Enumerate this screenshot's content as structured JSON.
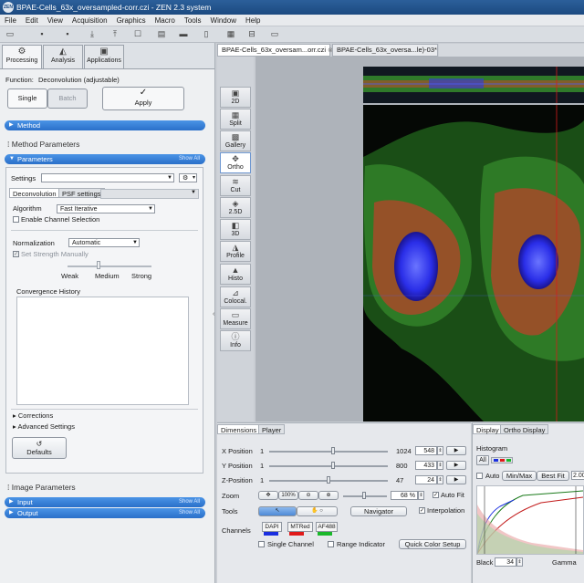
{
  "window": {
    "title": "BPAE-Cells_63x_oversampled-corr.czi - ZEN 2.3 system",
    "app_icon": "ZEN"
  },
  "menu": [
    "File",
    "Edit",
    "View",
    "Acquisition",
    "Graphics",
    "Macro",
    "Tools",
    "Window",
    "Help"
  ],
  "main_tabs": [
    {
      "label": "Processing",
      "icon": "gear-icon",
      "active": true
    },
    {
      "label": "Analysis",
      "icon": "chart-icon",
      "active": false
    },
    {
      "label": "Applications",
      "icon": "apps-icon",
      "active": false
    }
  ],
  "function": {
    "label": "Function:",
    "value": "Deconvolution (adjustable)"
  },
  "batch_toggle": {
    "single": "Single",
    "batch": "Batch"
  },
  "apply_button": {
    "icon": "✓",
    "label": "Apply"
  },
  "method_bar": "Method",
  "method_params_title": "Method Parameters",
  "parameters_bar": {
    "label": "Parameters",
    "show_all": "Show All"
  },
  "settings": {
    "label": "Settings",
    "value": ""
  },
  "subtabs": {
    "deconvolution": "Deconvolution",
    "psf": "PSF settings"
  },
  "algorithm": {
    "label": "Algorithm",
    "value": "Fast Iterative"
  },
  "enable_channel_selection": "Enable Channel Selection",
  "normalization": {
    "label": "Normalization",
    "value": "Automatic"
  },
  "set_strength": "Set Strength Manually",
  "strength_labels": [
    "Weak",
    "Medium",
    "Strong"
  ],
  "convergence_history": "Convergence History",
  "corrections": "Corrections",
  "advanced_settings": "Advanced Settings",
  "defaults_button": "Defaults",
  "image_parameters_title": "Image Parameters",
  "input_bar": {
    "label": "Input",
    "show_all": "Show All"
  },
  "output_bar": {
    "label": "Output",
    "show_all": "Show All"
  },
  "doc_tabs": [
    "BPAE-Cells_63x_oversam...orr.czi",
    "BPAE-Cells_63x_oversa...le)-03*"
  ],
  "view_buttons": [
    {
      "label": "2D",
      "icon": "2d-icon",
      "active": false
    },
    {
      "label": "Split",
      "icon": "split-icon",
      "active": false
    },
    {
      "label": "Gallery",
      "icon": "gallery-icon",
      "active": false
    },
    {
      "label": "Ortho",
      "icon": "ortho-icon",
      "active": true
    },
    {
      "label": "Cut",
      "icon": "cut-icon",
      "active": false
    },
    {
      "label": "2.5D",
      "icon": "2-5d-icon",
      "active": false
    },
    {
      "label": "3D",
      "icon": "3d-icon",
      "active": false
    },
    {
      "label": "Profile",
      "icon": "profile-icon",
      "active": false
    },
    {
      "label": "Histo",
      "icon": "histo-icon",
      "active": false
    },
    {
      "label": "Colocal.",
      "icon": "colocal-icon",
      "active": false
    },
    {
      "label": "Measure",
      "icon": "measure-icon",
      "active": false
    },
    {
      "label": "Info",
      "icon": "info-icon",
      "active": false
    }
  ],
  "bottom_tabs": {
    "dimensions": "Dimensions",
    "player": "Player"
  },
  "positions": [
    {
      "label": "X Position",
      "min": "1",
      "max": "1024",
      "value": "548",
      "fraction": 0.535
    },
    {
      "label": "Y Position",
      "min": "1",
      "max": "800",
      "value": "433",
      "fraction": 0.541
    },
    {
      "label": "Z-Position",
      "min": "1",
      "max": "47",
      "value": "24",
      "fraction": 0.5
    }
  ],
  "zoom": {
    "label": "Zoom",
    "value": "68 %",
    "percent_button": "100%",
    "auto_fit": "Auto Fit"
  },
  "tools": {
    "label": "Tools",
    "navigator": "Navigator",
    "interpolation": "Interpolation"
  },
  "channels": {
    "label": "Channels",
    "items": [
      {
        "name": "DAPI",
        "color": "#1a2fe0"
      },
      {
        "name": "MTRed",
        "color": "#e01a1a"
      },
      {
        "name": "AF488",
        "color": "#1ab82a"
      }
    ],
    "single_channel": "Single Channel",
    "range_indicator": "Range Indicator",
    "quick_color_setup": "Quick Color Setup"
  },
  "hist_tabs": {
    "display": "Display",
    "ortho_display": "Ortho Display"
  },
  "histogram": {
    "title": "Histogram",
    "all": "All",
    "auto": "Auto",
    "min_max": "Min/Max",
    "best_fit": "Best Fit",
    "gamma_value": "2.00",
    "black_label": "Black",
    "black_value": "34",
    "gamma_label": "Gamma"
  }
}
